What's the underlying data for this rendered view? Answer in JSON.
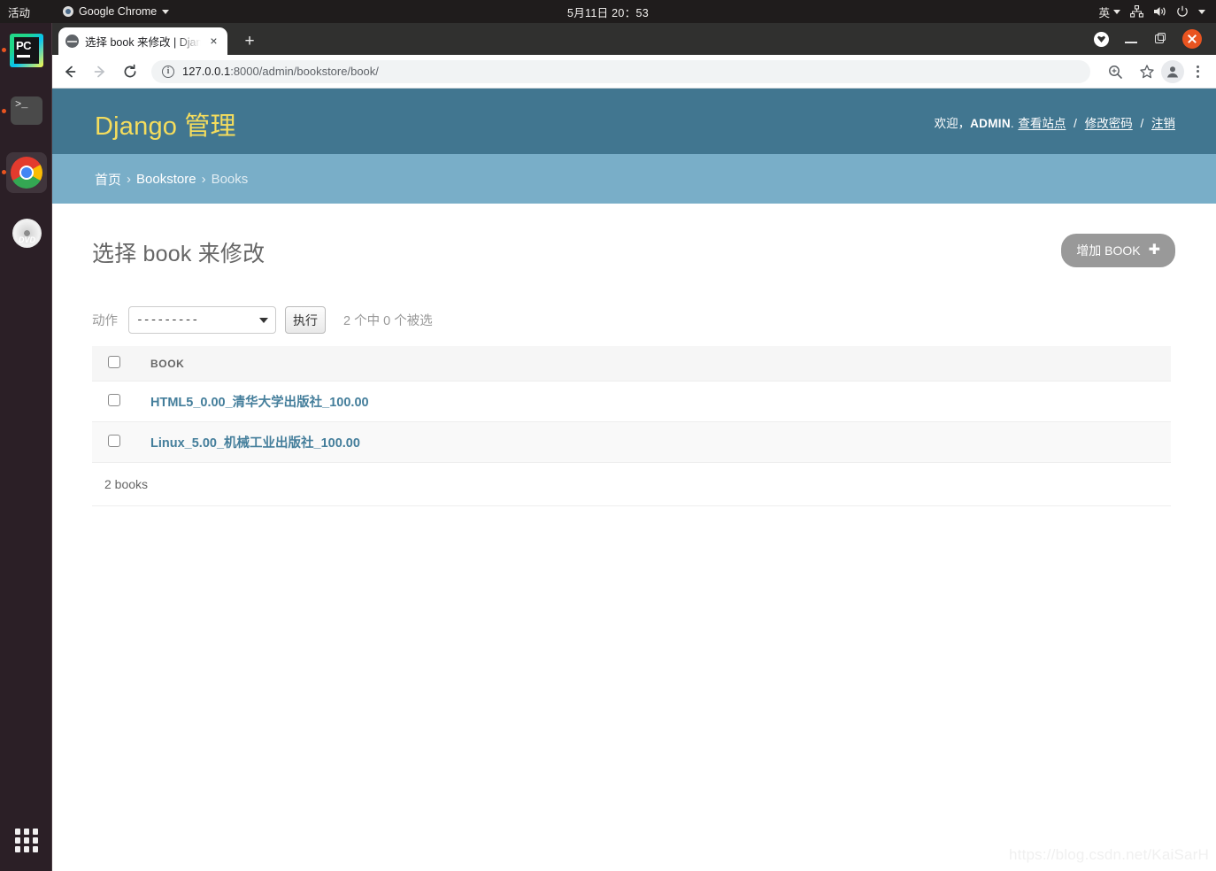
{
  "os_topbar": {
    "activities": "活动",
    "app_name": "Google Chrome",
    "clock": "5月11日 20：53",
    "ime": "英",
    "icons": [
      "chrome-dot-icon",
      "caret-down-icon",
      "network-icon",
      "volume-icon",
      "power-icon",
      "tray-caret-icon"
    ]
  },
  "dock": {
    "items": [
      {
        "name": "pycharm",
        "label": "PC",
        "running": true
      },
      {
        "name": "terminal",
        "label": ">_",
        "running": true
      },
      {
        "name": "google-chrome",
        "label": "",
        "running": true,
        "active": true
      },
      {
        "name": "dvd-drive",
        "label": "DVD",
        "running": false
      }
    ],
    "show_apps_label": "显示应用程序"
  },
  "browser": {
    "tab": {
      "title": "选择 book 来修改 | Djang",
      "close_label": "×"
    },
    "new_tab_label": "+",
    "nav": {
      "back": "←",
      "forward": "→",
      "reload": "C"
    },
    "omnibox": {
      "host": "127.0.0.1",
      "path": ":8000/admin/bookstore/book/",
      "full_url": "127.0.0.1:8000/admin/bookstore/book/"
    },
    "window_controls": [
      "pin-icon",
      "minimize-icon",
      "maximize-icon",
      "close-icon"
    ],
    "toolbar_right_icons": [
      "zoom-icon",
      "bookmark-star-icon",
      "profile-avatar-icon",
      "chrome-menu-icon"
    ]
  },
  "django": {
    "branding": "Django 管理",
    "usertools": {
      "welcome": "欢迎，",
      "username": "ADMIN",
      "dot": ".",
      "view_site": "查看站点",
      "change_password": "修改密码",
      "logout": "注销",
      "separator": "/"
    },
    "breadcrumbs": {
      "home": "首页",
      "app": "Bookstore",
      "model": "Books",
      "separator": "›"
    },
    "page_title": "选择 book 来修改",
    "add_button": {
      "label": "增加 BOOK",
      "plus": "✚"
    },
    "actions": {
      "label": "动作",
      "selected_option": "---------",
      "go_label": "执行",
      "counter": "2 个中 0 个被选"
    },
    "table": {
      "columns": [
        "BOOK"
      ],
      "rows": [
        {
          "title": "HTML5_0.00_清华大学出版社_100.00"
        },
        {
          "title": "Linux_5.00_机械工业出版社_100.00"
        }
      ]
    },
    "paginator": "2 books",
    "colors": {
      "header_bg": "#417690",
      "breadcrumb_bg": "#79aec8",
      "branding_text": "#f5dd5d",
      "link": "#447e9b",
      "add_button_bg": "#999999"
    }
  },
  "watermark": "https://blog.csdn.net/KaiSarH"
}
